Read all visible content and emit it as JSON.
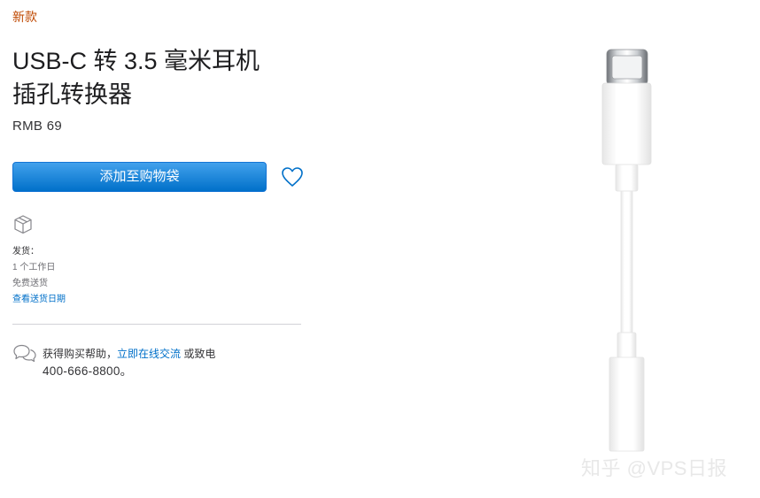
{
  "badge": "新款",
  "product": {
    "title_line1": "USB-C 转 3.5 毫米耳机",
    "title_line2": "插孔转换器",
    "price": "RMB 69"
  },
  "actions": {
    "add_to_bag": "添加至购物袋"
  },
  "shipping": {
    "label": "发货：",
    "time": "1 个工作日",
    "free": "免费送货",
    "check_dates": "查看送货日期"
  },
  "help": {
    "prefix": "获得购买帮助，",
    "chat_link": "立即在线交流",
    "suffix": " 或致电",
    "phone": "400-666-8800。"
  },
  "watermark": "知乎 @VPS日报",
  "colors": {
    "accent": "#0070c9",
    "badge": "#bf4800"
  },
  "icons": [
    "heart-icon",
    "box-icon",
    "chat-icon"
  ]
}
